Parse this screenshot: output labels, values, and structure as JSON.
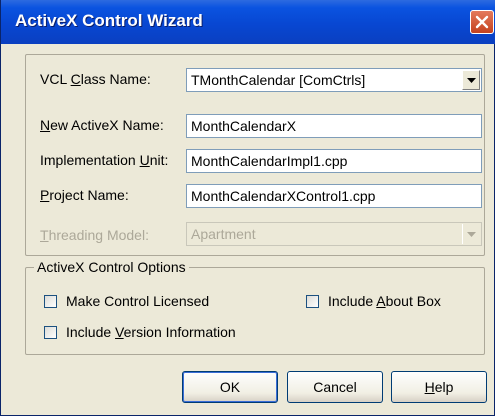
{
  "window": {
    "title": "ActiveX Control Wizard"
  },
  "fields": {
    "vcl_class_name": {
      "label_pre": "VCL ",
      "label_key": "C",
      "label_post": "lass Name:",
      "value": "TMonthCalendar  [ComCtrls]"
    },
    "new_activex_name": {
      "label_pre": "",
      "label_key": "N",
      "label_post": "ew ActiveX Name:",
      "value": "MonthCalendarX"
    },
    "implementation_unit": {
      "label_pre": "Implementation ",
      "label_key": "U",
      "label_post": "nit:",
      "value": "MonthCalendarImpl1.cpp"
    },
    "project_name": {
      "label_pre": "",
      "label_key": "P",
      "label_post": "roject Name:",
      "value": "MonthCalendarXControl1.cpp"
    },
    "threading_model": {
      "label_pre": "",
      "label_key": "T",
      "label_post": "hreading Model:",
      "value": "Apartment"
    }
  },
  "options": {
    "title": "ActiveX Control Options",
    "make_licensed": {
      "label": "Make Control Licensed",
      "checked": false
    },
    "about_box": {
      "label_pre": "Include ",
      "label_key": "A",
      "label_post": "bout Box",
      "checked": false
    },
    "version_info": {
      "label_pre": "Include ",
      "label_key": "V",
      "label_post": "ersion Information",
      "checked": false
    }
  },
  "buttons": {
    "ok": "OK",
    "cancel": "Cancel",
    "help_key": "H",
    "help_post": "elp"
  }
}
